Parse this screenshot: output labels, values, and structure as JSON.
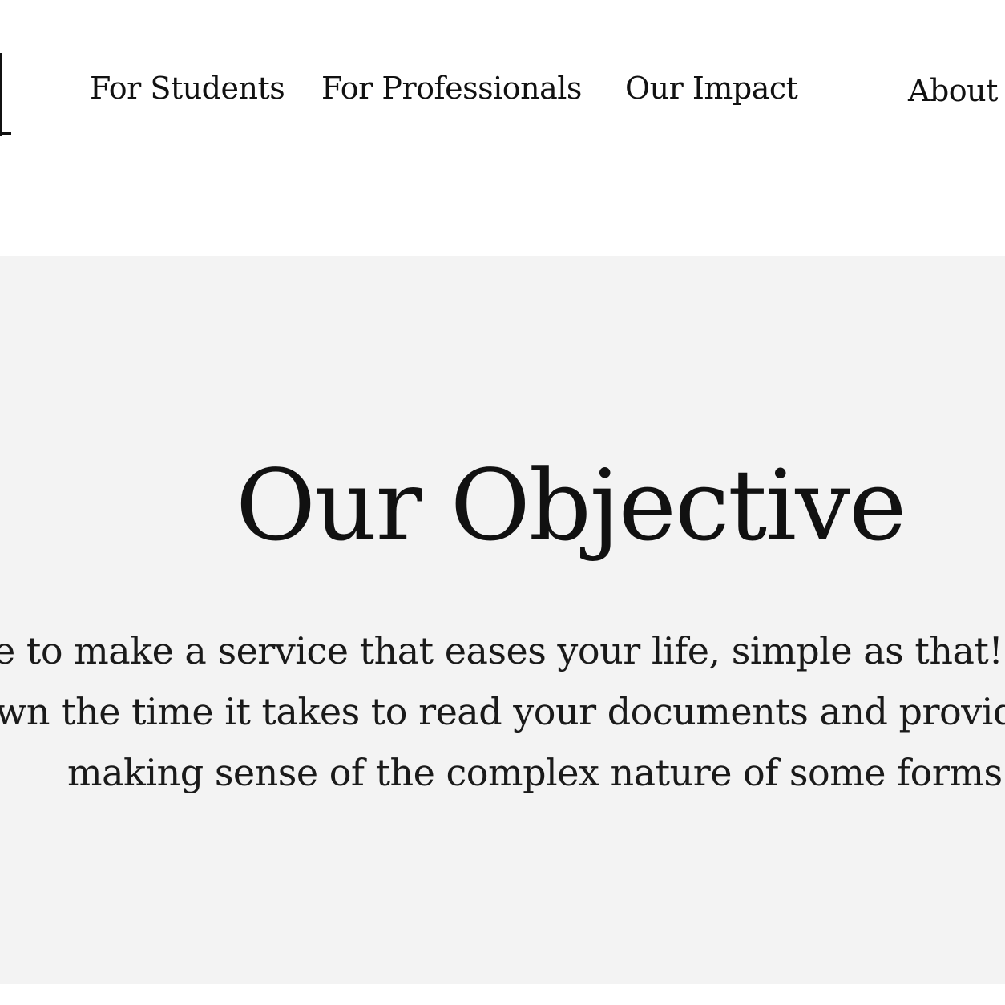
{
  "nav": {
    "items": [
      {
        "label": "For Students"
      },
      {
        "label": "For Professionals"
      },
      {
        "label": "Our Impact"
      },
      {
        "label": "About U"
      }
    ]
  },
  "objective": {
    "title": "Our Objective",
    "lines": [
      "e to make a service that eases your life, simple as that! By do",
      "wn the time it takes to read your documents and provide a",
      "making sense of the complex nature of some forms and"
    ]
  },
  "colors": {
    "header_background": "#ffffff",
    "section_background": "#f3f3f3",
    "text": "#111111"
  }
}
